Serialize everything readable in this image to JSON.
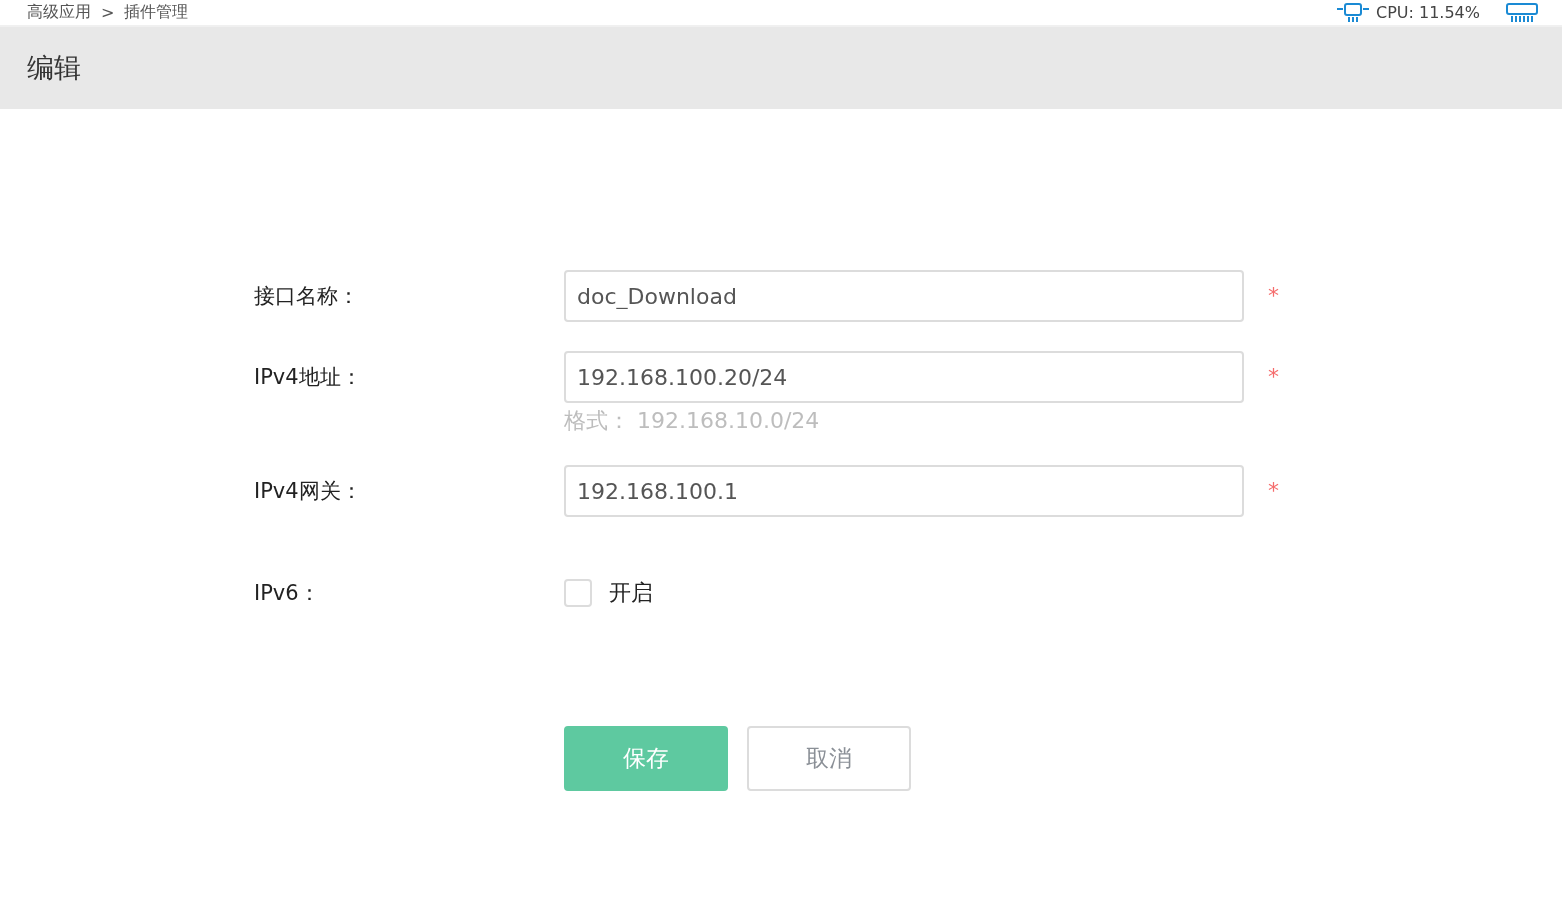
{
  "top_bar": {
    "breadcrumb": {
      "items": [
        "高级应用",
        "插件管理"
      ],
      "separator": ">"
    },
    "status": [
      {
        "kind": "cpu",
        "text": "CPU: 11.54%"
      },
      {
        "kind": "memory"
      }
    ]
  },
  "panel": {
    "title": "编辑"
  },
  "form": {
    "fields": [
      {
        "kind": "text",
        "label": "接口名称：",
        "value": "doc_Download",
        "required_mark": "*"
      },
      {
        "kind": "text",
        "label": "IPv4地址：",
        "value": "192.168.100.20/24",
        "required_mark": "*",
        "hint": "格式： 192.168.10.0/24"
      },
      {
        "kind": "text",
        "label": "IPv4网关：",
        "value": "192.168.100.1",
        "required_mark": "*"
      },
      {
        "kind": "checkbox",
        "label": "IPv6：",
        "checked": false,
        "option": "开启"
      }
    ],
    "buttons": [
      {
        "kind": "primary",
        "label": "保存"
      },
      {
        "kind": "default",
        "label": "取消"
      }
    ]
  }
}
